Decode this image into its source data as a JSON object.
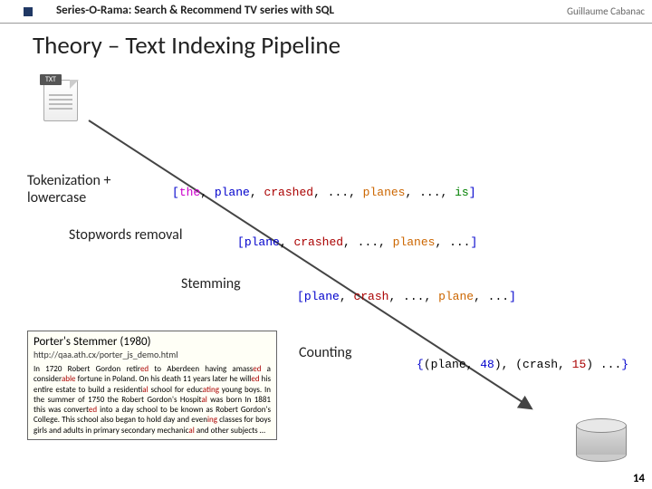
{
  "header": {
    "title": "Series-O-Rama: Search & Recommend TV series with SQL",
    "author": "Guillaume Cabanac"
  },
  "title": "Theory – Text Indexing Pipeline",
  "file_label": "TXT",
  "stages": {
    "tokenization": "Tokenization + lowercase",
    "stopwords": "Stopwords removal",
    "stemming": "Stemming",
    "counting": "Counting"
  },
  "tokens": {
    "line1": {
      "lbr": "[",
      "t1": "the",
      "c1": ", ",
      "t2": "plane",
      "c2": ", ",
      "t3": "crashed",
      "c3": ", ..., ",
      "t4": "planes",
      "c4": ", ..., ",
      "t5": "is",
      "rbr": "]"
    },
    "line2": {
      "lbr": "[",
      "t1": "plane",
      "c1": ", ",
      "t2": "crashed",
      "c2": ", ..., ",
      "t3": "planes",
      "c3": ", ...",
      "rbr": "]"
    },
    "line3": {
      "lbr": "[",
      "t1": "plane",
      "c1": ", ",
      "t2": "crash",
      "c2": ", ..., ",
      "t3": "plane",
      "c3": ", ...",
      "rbr": "]"
    },
    "line4": {
      "lbr": "{",
      "p1a": "(plane, ",
      "p1b": "48",
      "p1c": "), ",
      "p2a": "(crash, ",
      "p2b": "15",
      "p2c": ") ...",
      "rbr": "}"
    }
  },
  "porter": {
    "title": "Porter's Stemmer (1980)",
    "link": "http://qaa.ath.cx/porter_js_demo.html",
    "body_pre": "In 1720 Robert Gordon retir",
    "h1": "ed",
    "body_2": " to Aberdeen having amass",
    "h2": "ed",
    "body_3": " a consider",
    "h3": "able",
    "body_4": " fortune in Poland. On his death 11 years later he will",
    "h4": "ed",
    "body_5": " his entire estate to build a residenti",
    "h5": "al",
    "body_6": " school for educ",
    "h6": "ating",
    "body_7": " young boys. In the summer of 1750 the Robert Gordon's Hospit",
    "h7": "al",
    "body_8": " was born In 1881 this was convert",
    "h8": "ed",
    "body_9": " into a day school to be known as Robert Gordon's College. This school also began to hold day and even",
    "h9": "ing",
    "body_10": " classes for boys girls and adults in primary secondary mechanic",
    "h10": "al",
    "body_11": " and other subjects …"
  },
  "page_number": "14"
}
